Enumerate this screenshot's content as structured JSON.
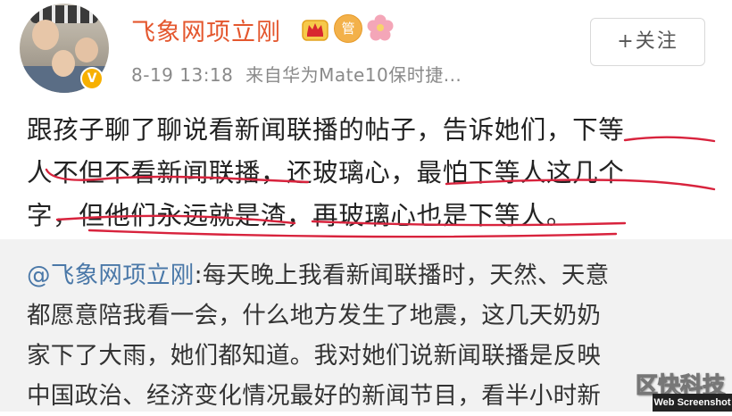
{
  "post": {
    "username": "飞象网项立刚",
    "member_badge_icon": "crown-icon",
    "member_badge_text": "管",
    "flower_icon": "flower-icon",
    "timestamp": "8-19 13:18",
    "source": "来自华为Mate10保时捷...",
    "follow_label": "+关注",
    "verified_badge": "V",
    "body_lines": [
      "跟孩子聊了聊说看新闻联播的帖子，告诉她们，下等",
      "人不但不看新闻联播，还玻璃心，最怕下等人这几个",
      "字，但他们永远就是渣，再玻璃心也是下等人。"
    ]
  },
  "repost": {
    "mention": "@飞象网项立刚",
    "line1_rest": ":每天晚上我看新闻联播时，天然、天意",
    "lines": [
      "都愿意陪我看一会，什么地方发生了地震，这几天奶奶",
      "家下了大雨，她们都知道。我对她们说新闻联播是反映",
      "中国政治、经济变化情况最好的新闻节目，看半小时新"
    ]
  },
  "watermark": {
    "cn": "区快科技",
    "en": "Web Screenshot"
  },
  "colors": {
    "username": "#e4572e",
    "underline": "#d8233d",
    "mention": "#4a78a8",
    "repost_bg": "#f2f2f2"
  }
}
